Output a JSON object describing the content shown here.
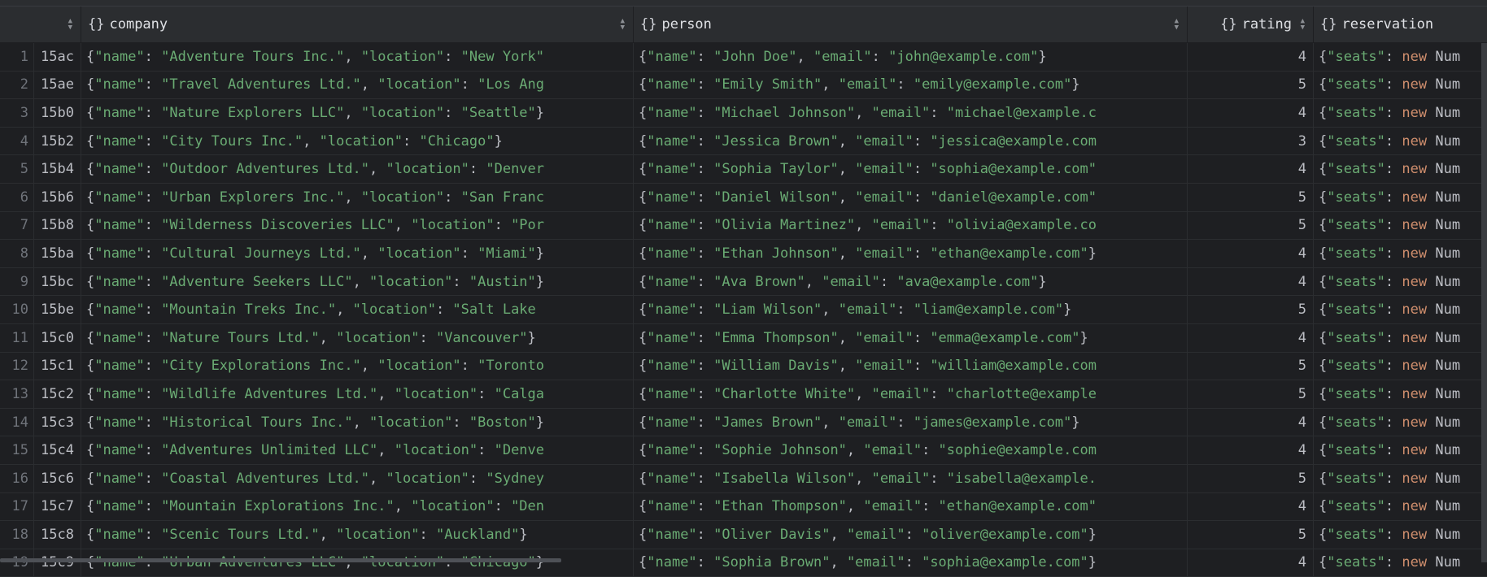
{
  "header": {
    "columns": [
      {
        "label": "",
        "icon": "sort-icon"
      },
      {
        "label": "company",
        "icon": "braces-icon"
      },
      {
        "label": "person",
        "icon": "braces-icon"
      },
      {
        "label": "rating",
        "icon": "braces-icon"
      },
      {
        "label": "reservation",
        "icon": "braces-icon"
      }
    ],
    "braces": "{}"
  },
  "colors": {
    "background": "#1e1f22",
    "header": "#2b2d30",
    "string": "#6aab73",
    "keyword": "#cf8e6d",
    "text": "#bcbec4"
  },
  "rows": [
    {
      "n": "1",
      "id": "15ac",
      "company": "{\"name\": \"Adventure Tours Inc.\", \"location\": \"New York\"",
      "person": "{\"name\": \"John Doe\", \"email\": \"john@example.com\"}",
      "rating": "4",
      "reservation": "{\"seats\": new Num"
    },
    {
      "n": "2",
      "id": "15ae",
      "company": "{\"name\": \"Travel Adventures Ltd.\", \"location\": \"Los Ang",
      "person": "{\"name\": \"Emily Smith\", \"email\": \"emily@example.com\"}",
      "rating": "5",
      "reservation": "{\"seats\": new Num"
    },
    {
      "n": "3",
      "id": "15b0",
      "company": "{\"name\": \"Nature Explorers LLC\", \"location\": \"Seattle\"}",
      "person": "{\"name\": \"Michael Johnson\", \"email\": \"michael@example.c",
      "rating": "4",
      "reservation": "{\"seats\": new Num"
    },
    {
      "n": "4",
      "id": "15b2",
      "company": "{\"name\": \"City Tours Inc.\", \"location\": \"Chicago\"}",
      "person": "{\"name\": \"Jessica Brown\", \"email\": \"jessica@example.com",
      "rating": "3",
      "reservation": "{\"seats\": new Num"
    },
    {
      "n": "5",
      "id": "15b4",
      "company": "{\"name\": \"Outdoor Adventures Ltd.\", \"location\": \"Denver",
      "person": "{\"name\": \"Sophia Taylor\", \"email\": \"sophia@example.com\"",
      "rating": "4",
      "reservation": "{\"seats\": new Num"
    },
    {
      "n": "6",
      "id": "15b6",
      "company": "{\"name\": \"Urban Explorers Inc.\", \"location\": \"San Franc",
      "person": "{\"name\": \"Daniel Wilson\", \"email\": \"daniel@example.com\"",
      "rating": "5",
      "reservation": "{\"seats\": new Num"
    },
    {
      "n": "7",
      "id": "15b8",
      "company": "{\"name\": \"Wilderness Discoveries LLC\", \"location\": \"Por",
      "person": "{\"name\": \"Olivia Martinez\", \"email\": \"olivia@example.co",
      "rating": "5",
      "reservation": "{\"seats\": new Num"
    },
    {
      "n": "8",
      "id": "15ba",
      "company": "{\"name\": \"Cultural Journeys Ltd.\", \"location\": \"Miami\"}",
      "person": "{\"name\": \"Ethan Johnson\", \"email\": \"ethan@example.com\"}",
      "rating": "4",
      "reservation": "{\"seats\": new Num"
    },
    {
      "n": "9",
      "id": "15bc",
      "company": "{\"name\": \"Adventure Seekers LLC\", \"location\": \"Austin\"}",
      "person": "{\"name\": \"Ava Brown\", \"email\": \"ava@example.com\"}",
      "rating": "4",
      "reservation": "{\"seats\": new Num"
    },
    {
      "n": "10",
      "id": "15be",
      "company": "{\"name\": \"Mountain Treks Inc.\", \"location\": \"Salt Lake",
      "person": "{\"name\": \"Liam Wilson\", \"email\": \"liam@example.com\"}",
      "rating": "5",
      "reservation": "{\"seats\": new Num"
    },
    {
      "n": "11",
      "id": "15c0",
      "company": "{\"name\": \"Nature Tours Ltd.\", \"location\": \"Vancouver\"}",
      "person": "{\"name\": \"Emma Thompson\", \"email\": \"emma@example.com\"}",
      "rating": "4",
      "reservation": "{\"seats\": new Num"
    },
    {
      "n": "12",
      "id": "15c1",
      "company": "{\"name\": \"City Explorations Inc.\", \"location\": \"Toronto",
      "person": "{\"name\": \"William Davis\", \"email\": \"william@example.com",
      "rating": "5",
      "reservation": "{\"seats\": new Num"
    },
    {
      "n": "13",
      "id": "15c2",
      "company": "{\"name\": \"Wildlife Adventures Ltd.\", \"location\": \"Calga",
      "person": "{\"name\": \"Charlotte White\", \"email\": \"charlotte@example",
      "rating": "5",
      "reservation": "{\"seats\": new Num"
    },
    {
      "n": "14",
      "id": "15c3",
      "company": "{\"name\": \"Historical Tours Inc.\", \"location\": \"Boston\"}",
      "person": "{\"name\": \"James Brown\", \"email\": \"james@example.com\"}",
      "rating": "4",
      "reservation": "{\"seats\": new Num"
    },
    {
      "n": "15",
      "id": "15c4",
      "company": "{\"name\": \"Adventures Unlimited LLC\", \"location\": \"Denve",
      "person": "{\"name\": \"Sophie Johnson\", \"email\": \"sophie@example.com",
      "rating": "4",
      "reservation": "{\"seats\": new Num"
    },
    {
      "n": "16",
      "id": "15c6",
      "company": "{\"name\": \"Coastal Adventures Ltd.\", \"location\": \"Sydney",
      "person": "{\"name\": \"Isabella Wilson\", \"email\": \"isabella@example.",
      "rating": "5",
      "reservation": "{\"seats\": new Num"
    },
    {
      "n": "17",
      "id": "15c7",
      "company": "{\"name\": \"Mountain Explorations Inc.\", \"location\": \"Den",
      "person": "{\"name\": \"Ethan Thompson\", \"email\": \"ethan@example.com\"",
      "rating": "4",
      "reservation": "{\"seats\": new Num"
    },
    {
      "n": "18",
      "id": "15c8",
      "company": "{\"name\": \"Scenic Tours Ltd.\", \"location\": \"Auckland\"}",
      "person": "{\"name\": \"Oliver Davis\", \"email\": \"oliver@example.com\"}",
      "rating": "5",
      "reservation": "{\"seats\": new Num"
    },
    {
      "n": "19",
      "id": "15c9",
      "company": "{\"name\": \"Urban Adventures LLC\", \"location\": \"Chicago\"}",
      "person": "{\"name\": \"Sophia Brown\", \"email\": \"sophia@example.com\"}",
      "rating": "4",
      "reservation": "{\"seats\": new Num"
    }
  ]
}
